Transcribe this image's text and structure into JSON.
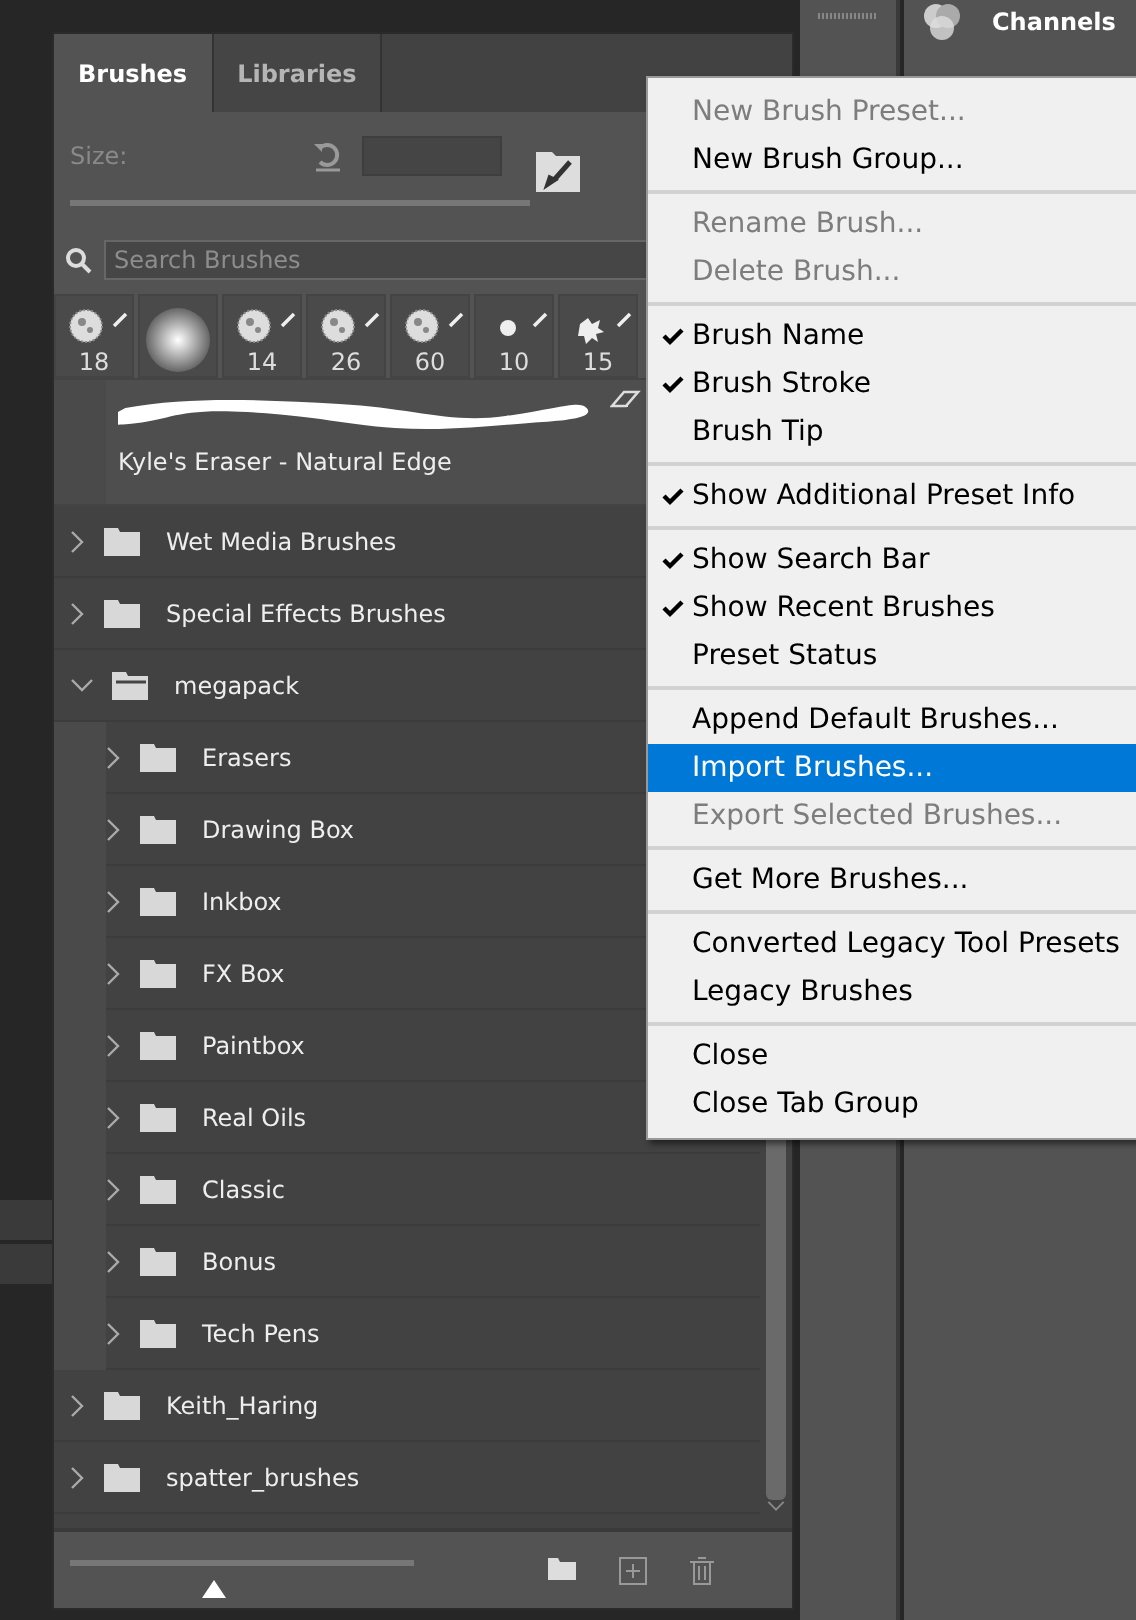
{
  "tabs": [
    {
      "label": "Brushes",
      "selected": true
    },
    {
      "label": "Libraries",
      "selected": false
    }
  ],
  "size": {
    "label": "Size:"
  },
  "search": {
    "placeholder": "Search Brushes"
  },
  "recent_brushes": [
    {
      "kind": "texture",
      "size": "18"
    },
    {
      "kind": "soft"
    },
    {
      "kind": "texture",
      "size": "14"
    },
    {
      "kind": "texture",
      "size": "26"
    },
    {
      "kind": "texture",
      "size": "60"
    },
    {
      "kind": "dot",
      "size": "10"
    },
    {
      "kind": "splatter",
      "size": "15"
    }
  ],
  "preview": {
    "name": "Kyle's Eraser - Natural Edge"
  },
  "tree": [
    {
      "label": "Wet Media Brushes",
      "expanded": false
    },
    {
      "label": "Special Effects Brushes",
      "expanded": false
    },
    {
      "label": "megapack",
      "expanded": true,
      "children": [
        {
          "label": "Erasers",
          "expanded": false
        },
        {
          "label": "Drawing Box",
          "expanded": false
        },
        {
          "label": "Inkbox",
          "expanded": false
        },
        {
          "label": "FX Box",
          "expanded": false
        },
        {
          "label": "Paintbox",
          "expanded": false
        },
        {
          "label": "Real Oils",
          "expanded": false
        },
        {
          "label": "Classic",
          "expanded": false
        },
        {
          "label": "Bonus",
          "expanded": false
        },
        {
          "label": "Tech Pens",
          "expanded": false
        }
      ]
    },
    {
      "label": "Keith_Haring",
      "expanded": false
    },
    {
      "label": "spatter_brushes",
      "expanded": false
    }
  ],
  "footer": {
    "level": 0.42
  },
  "side_panel": {
    "title": "Channels"
  },
  "menu": [
    [
      {
        "label": "New Brush Preset...",
        "disabled": true,
        "checked": false,
        "selected": false
      },
      {
        "label": "New Brush Group...",
        "disabled": false,
        "checked": false,
        "selected": false
      }
    ],
    [
      {
        "label": "Rename Brush...",
        "disabled": true,
        "checked": false,
        "selected": false
      },
      {
        "label": "Delete Brush...",
        "disabled": true,
        "checked": false,
        "selected": false
      }
    ],
    [
      {
        "label": "Brush Name",
        "disabled": false,
        "checked": true,
        "selected": false
      },
      {
        "label": "Brush Stroke",
        "disabled": false,
        "checked": true,
        "selected": false
      },
      {
        "label": "Brush Tip",
        "disabled": false,
        "checked": false,
        "selected": false
      }
    ],
    [
      {
        "label": "Show Additional Preset Info",
        "disabled": false,
        "checked": true,
        "selected": false
      }
    ],
    [
      {
        "label": "Show Search Bar",
        "disabled": false,
        "checked": true,
        "selected": false
      },
      {
        "label": "Show Recent Brushes",
        "disabled": false,
        "checked": true,
        "selected": false
      },
      {
        "label": "Preset Status",
        "disabled": false,
        "checked": false,
        "selected": false
      }
    ],
    [
      {
        "label": "Append Default Brushes...",
        "disabled": false,
        "checked": false,
        "selected": false
      },
      {
        "label": "Import Brushes...",
        "disabled": false,
        "checked": false,
        "selected": true
      },
      {
        "label": "Export Selected Brushes...",
        "disabled": true,
        "checked": false,
        "selected": false
      }
    ],
    [
      {
        "label": "Get More Brushes...",
        "disabled": false,
        "checked": false,
        "selected": false
      }
    ],
    [
      {
        "label": "Converted Legacy Tool Presets",
        "disabled": false,
        "checked": false,
        "selected": false
      },
      {
        "label": "Legacy Brushes",
        "disabled": false,
        "checked": false,
        "selected": false
      }
    ],
    [
      {
        "label": "Close",
        "disabled": false,
        "checked": false,
        "selected": false
      },
      {
        "label": "Close Tab Group",
        "disabled": false,
        "checked": false,
        "selected": false
      }
    ]
  ]
}
